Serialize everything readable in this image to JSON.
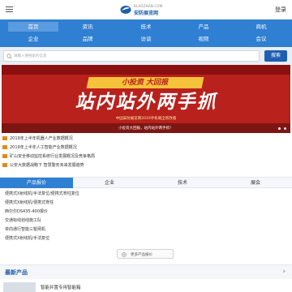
{
  "header": {
    "logo_url": "BLAOZHAN.COM",
    "logo_name": "安防展览网",
    "login_label": "登录"
  },
  "nav": {
    "items": [
      {
        "label": "首页",
        "active": true
      },
      {
        "label": "资讯",
        "active": false
      },
      {
        "label": "技术",
        "active": false
      },
      {
        "label": "产品",
        "active": false
      },
      {
        "label": "商机",
        "active": false
      },
      {
        "label": "企业",
        "active": false
      },
      {
        "label": "品牌",
        "active": false
      },
      {
        "label": "访谈",
        "active": false
      },
      {
        "label": "视频",
        "active": false
      },
      {
        "label": "会议",
        "active": false
      }
    ]
  },
  "search": {
    "placeholder": "请输入要搜索的信息",
    "button_label": "搜索"
  },
  "banner": {
    "tag": "小投资  大回报",
    "headline": "站内站外两手抓",
    "subline": "中国安防展览网2019手机端全新改版",
    "caption": "小投资大回报，站内站外两手抓！",
    "slide_count": 2,
    "active_slide": 1
  },
  "news": [
    "2019年上半年机器人产业数据概况",
    "2019年上半年人工智能产业数据概况",
    "矿山安全移动监控系统行业发展概况及竞争格局",
    "公安大数据战略下 智慧警务未来发展趋势"
  ],
  "tabs": [
    {
      "label": "产品报价",
      "active": true
    },
    {
      "label": "企业",
      "active": false
    },
    {
      "label": "技术",
      "active": false
    },
    {
      "label": "展会",
      "active": false
    }
  ],
  "products": [
    "便携式X射线机/手法复位/便携式脊柱复位",
    "便携式X射线机/便携式脊柱",
    "西尔尔DS435-400报价",
    "交通标线划线施工队",
    "单向通行智能三辊闸机",
    "便携式X射线机/手法复位"
  ],
  "more_button_label": "更多产品报价",
  "newest": {
    "title": "最新产品",
    "product_name": "智能并置专用智能箱"
  },
  "colors": {
    "nav_blue": "#2f7fd2",
    "brand_blue": "#1c5fa9",
    "banner_red": "#b8211c",
    "accent_yellow": "#f4c23b",
    "bullet_orange": "#e08b1b"
  }
}
